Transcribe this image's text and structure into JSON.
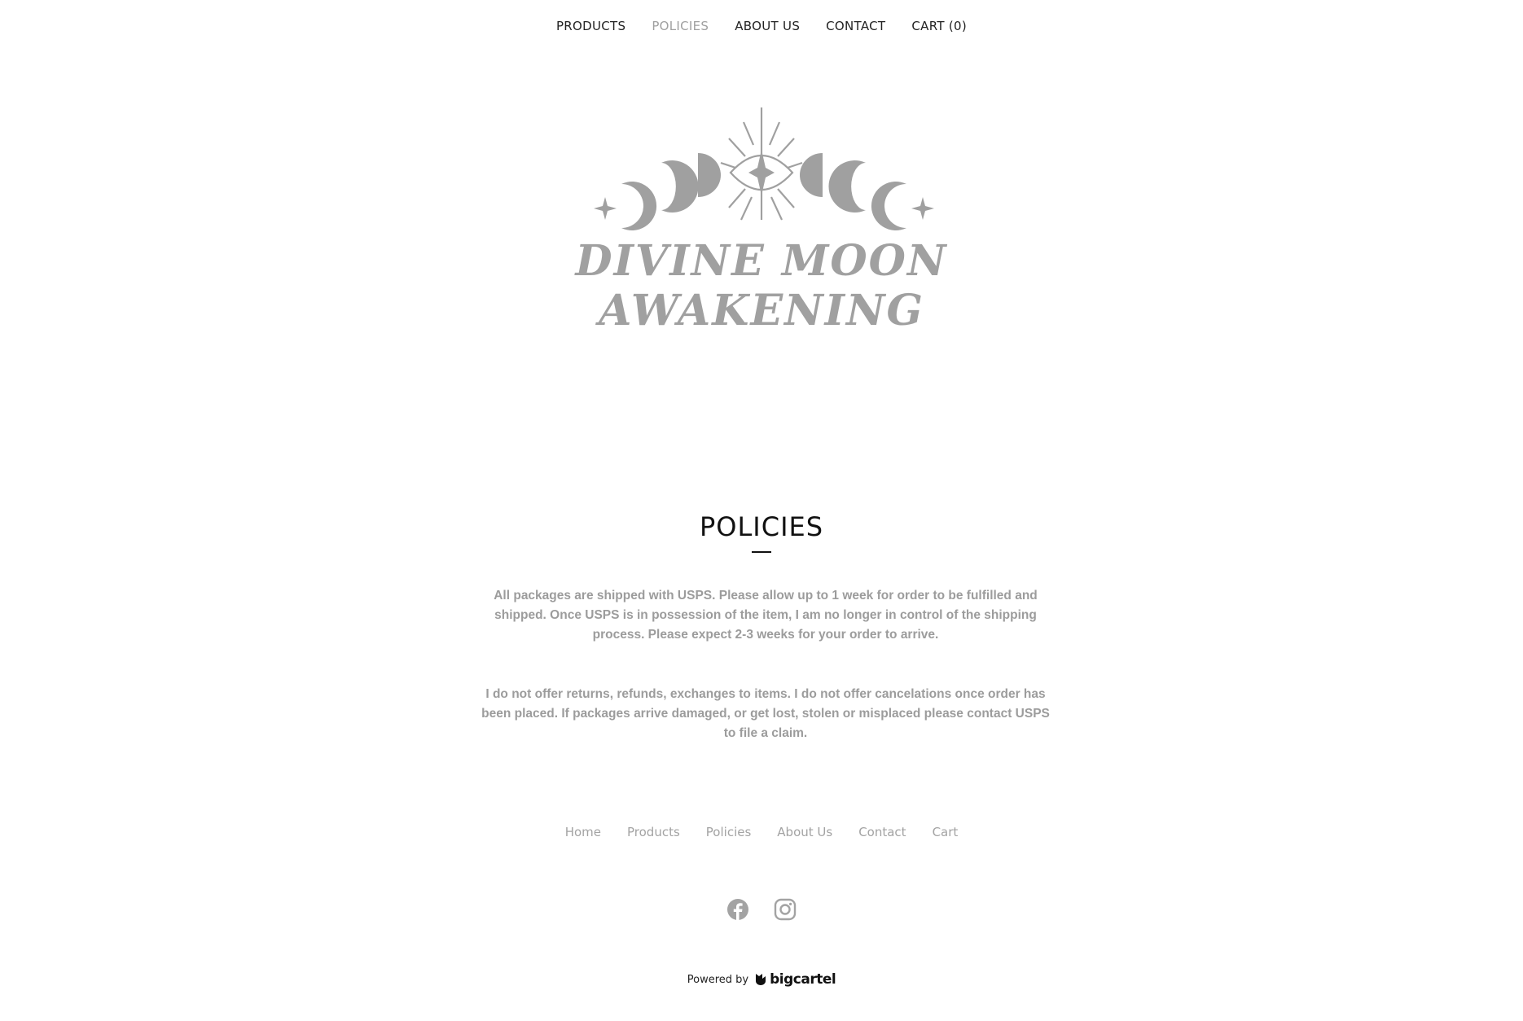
{
  "nav": {
    "items": [
      {
        "label": "PRODUCTS",
        "active": false
      },
      {
        "label": "POLICIES",
        "active": true
      },
      {
        "label": "ABOUT US",
        "active": false
      },
      {
        "label": "CONTACT",
        "active": false
      },
      {
        "label": "CART (0)",
        "active": false
      }
    ]
  },
  "logo": {
    "text": "DIVINE MOON AWAKENING",
    "color": "#a0a0a0"
  },
  "page": {
    "title": "POLICIES",
    "paragraphs": [
      "All packages are shipped with USPS.  Please allow up to 1 week for order to be fulfilled and shipped. Once USPS is in possession of the item, I am no longer in control of the shipping process. Please expect 2-3 weeks for your order to arrive.",
      "I do not offer returns, refunds, exchanges to items. I do not offer cancelations once order has been placed. If packages arrive damaged, or get lost, stolen or misplaced please contact USPS to file a claim."
    ]
  },
  "footer": {
    "links": [
      "Home",
      "Products",
      "Policies",
      "About Us",
      "Contact",
      "Cart"
    ],
    "social": [
      {
        "icon": "facebook-icon"
      },
      {
        "icon": "instagram-icon"
      }
    ],
    "powered_by": "Powered by",
    "brand": "bigcartel"
  },
  "colors": {
    "muted": "#a0a0a0",
    "text": "#222222",
    "background": "#ffffff"
  }
}
